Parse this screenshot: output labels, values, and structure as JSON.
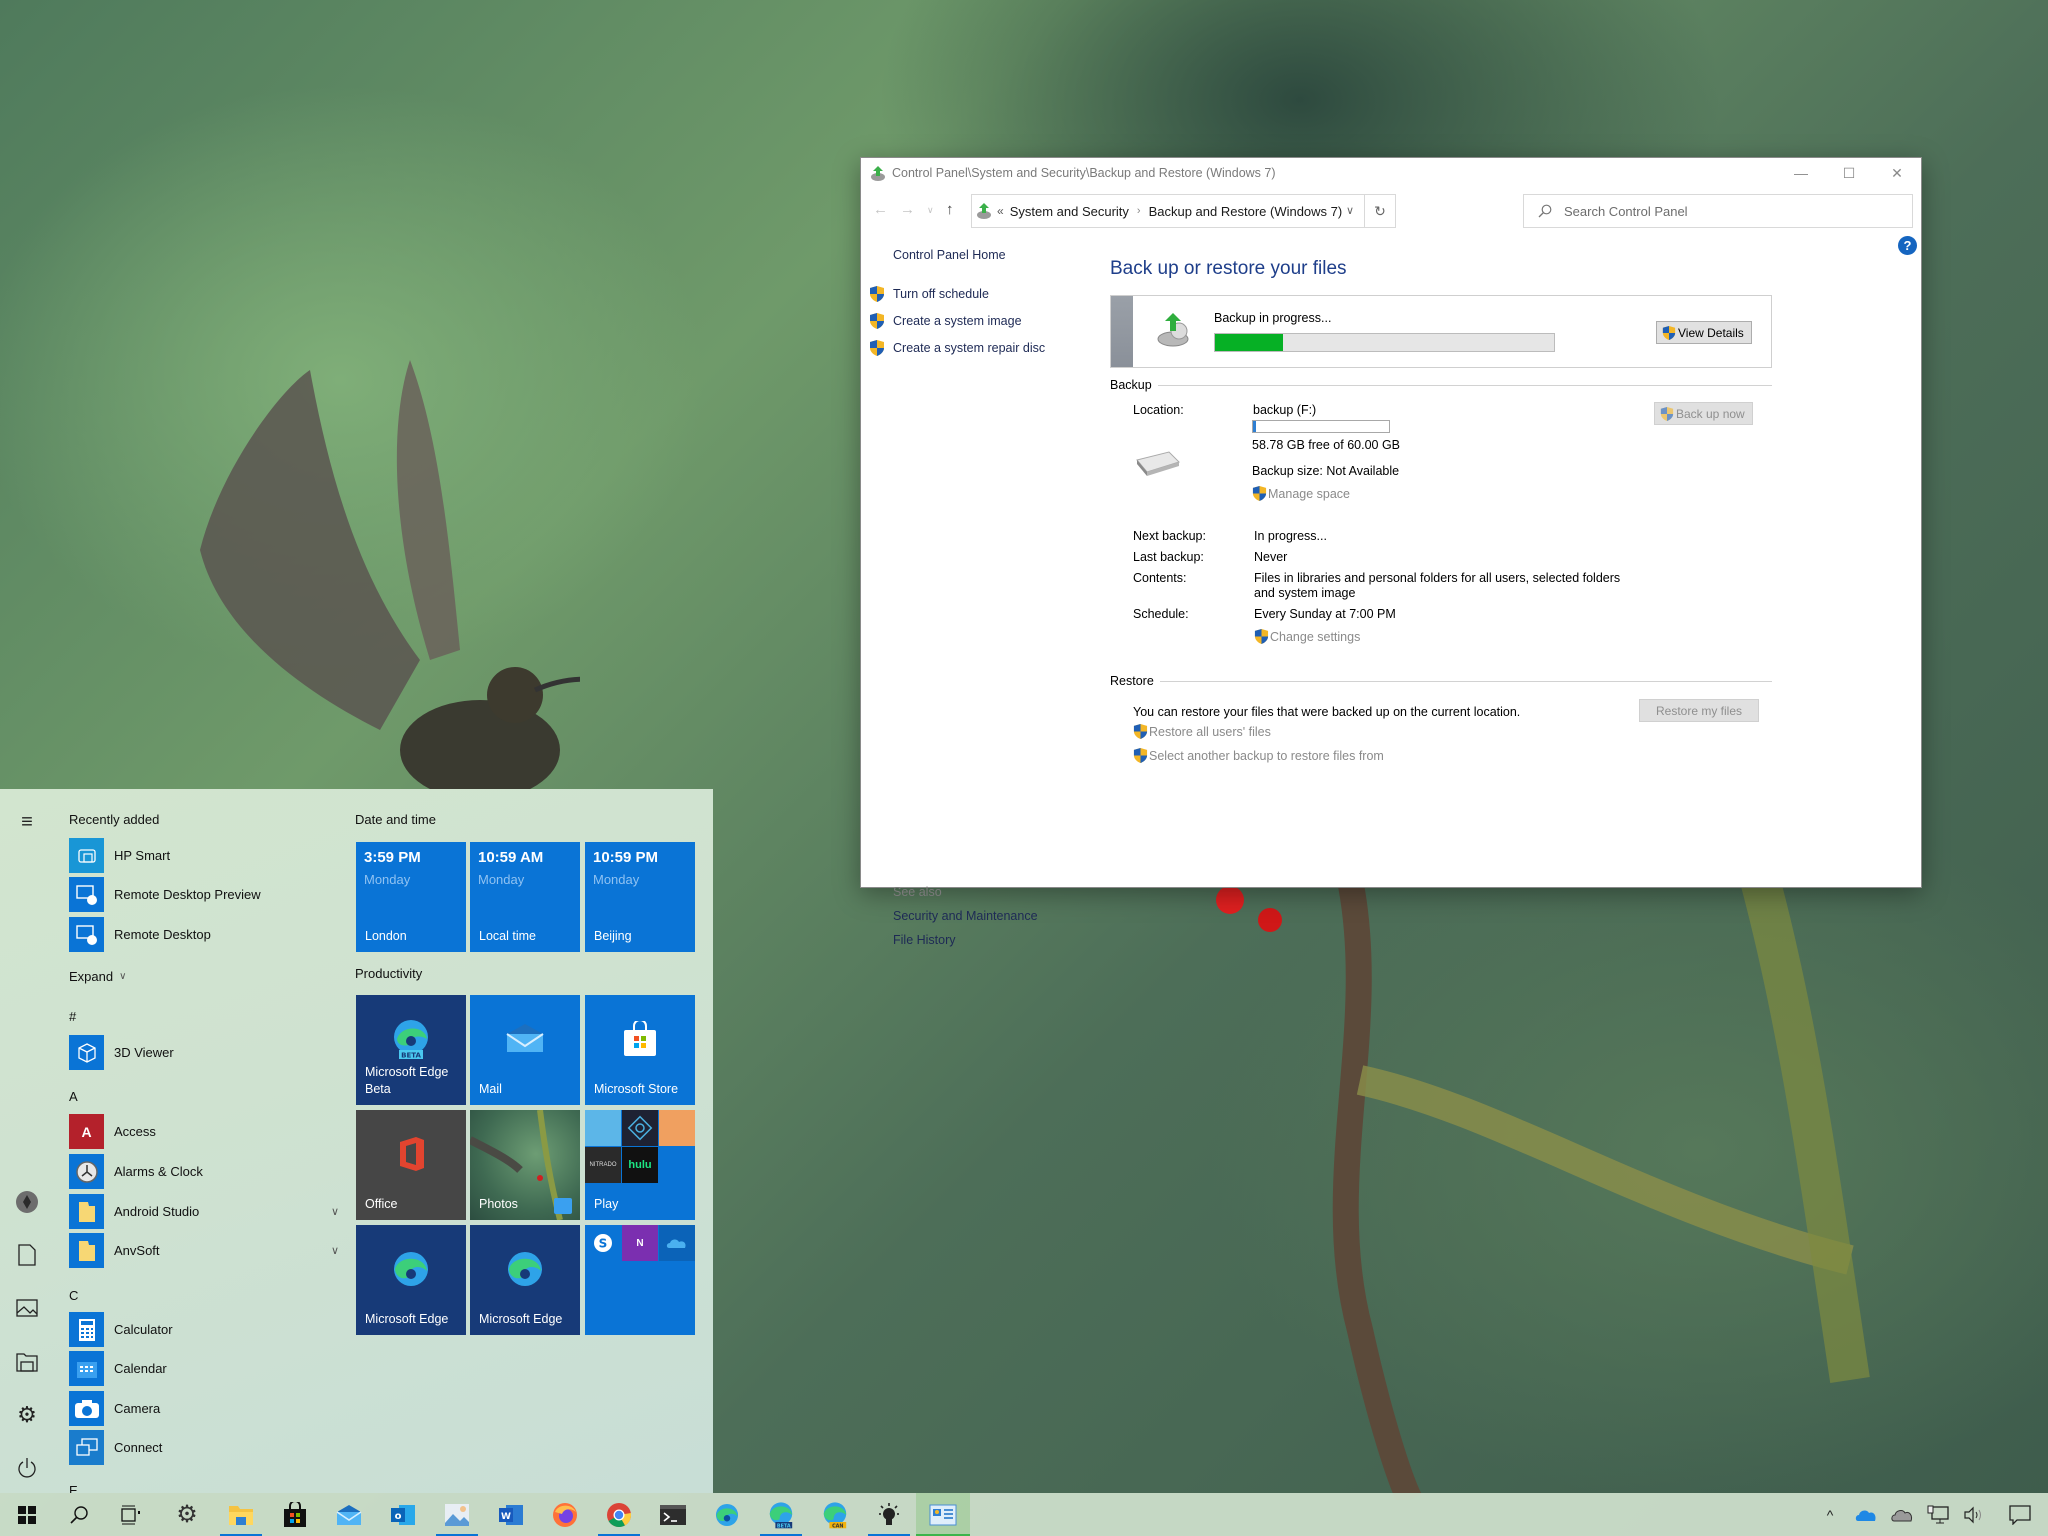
{
  "window": {
    "title": "Control Panel\\System and Security\\Backup and Restore (Windows 7)",
    "controls": {
      "minimize": "—",
      "maximize": "☐",
      "close": "✕"
    },
    "nav": {
      "back": "←",
      "forward": "→",
      "recent": "∨",
      "up": "↑",
      "breadcrumb_overflow": "«",
      "breadcrumb": [
        "System and Security",
        "Backup and Restore (Windows 7)"
      ],
      "breadcrumb_sep": "›",
      "dropdown": "∨",
      "refresh": "↻",
      "search_placeholder": "Search Control Panel"
    },
    "help": "?",
    "left_pane": {
      "home": "Control Panel Home",
      "tasks": [
        "Turn off schedule",
        "Create a system image",
        "Create a system repair disc"
      ],
      "see_also_header": "See also",
      "see_also": [
        "Security and Maintenance",
        "File History"
      ]
    },
    "main": {
      "title": "Back up or restore your files",
      "status": {
        "text": "Backup in progress...",
        "progress_fraction": 0.2,
        "view_details_label": "View Details"
      },
      "backup_section": {
        "header": "Backup",
        "location_label": "Location:",
        "location_value": "backup (F:)",
        "drive_used_fraction": 0.02,
        "free_space": "58.78 GB free of 60.00 GB",
        "backup_size": "Backup size: Not Available",
        "manage_space": "Manage space",
        "back_up_now": "Back up now",
        "next_backup_label": "Next backup:",
        "next_backup_value": "In progress...",
        "last_backup_label": "Last backup:",
        "last_backup_value": "Never",
        "contents_label": "Contents:",
        "contents_value": "Files in libraries and personal folders for all users, selected folders and system image",
        "schedule_label": "Schedule:",
        "schedule_value": "Every Sunday at 7:00 PM",
        "change_settings": "Change settings"
      },
      "restore_section": {
        "header": "Restore",
        "description": "You can restore your files that were backed up on the current location.",
        "restore_all_users": "Restore all users' files",
        "select_another": "Select another backup to restore files from",
        "restore_my_files": "Restore my files"
      }
    }
  },
  "start_menu": {
    "hamburger": "≡",
    "recently_added_header": "Recently added",
    "recently_added": [
      "HP Smart",
      "Remote Desktop Preview",
      "Remote Desktop"
    ],
    "expand_label": "Expand",
    "groups": [
      {
        "letter": "#",
        "apps": [
          {
            "name": "3D Viewer"
          }
        ]
      },
      {
        "letter": "A",
        "apps": [
          {
            "name": "Access"
          },
          {
            "name": "Alarms & Clock"
          },
          {
            "name": "Android Studio",
            "expandable": true
          },
          {
            "name": "AnvSoft",
            "expandable": true
          }
        ]
      },
      {
        "letter": "C",
        "apps": [
          {
            "name": "Calculator"
          },
          {
            "name": "Calendar"
          },
          {
            "name": "Camera"
          },
          {
            "name": "Connect"
          }
        ]
      },
      {
        "letter": "E",
        "apps": []
      }
    ],
    "rail": [
      "user-avatar",
      "documents",
      "pictures",
      "file-explorer",
      "settings",
      "power"
    ],
    "tiles": {
      "date_time_header": "Date and time",
      "clocks": [
        {
          "time": "3:59 PM",
          "day": "Monday",
          "city": "London"
        },
        {
          "time": "10:59 AM",
          "day": "Monday",
          "city": "Local time"
        },
        {
          "time": "10:59 PM",
          "day": "Monday",
          "city": "Beijing"
        }
      ],
      "productivity_header": "Productivity",
      "apps": [
        {
          "label": "Microsoft Edge Beta",
          "badge": "BETA"
        },
        {
          "label": "Mail"
        },
        {
          "label": "Microsoft Store"
        },
        {
          "label": "Office"
        },
        {
          "label": "Photos"
        },
        {
          "label": "Play",
          "mini": [
            "Candy",
            "Photoshop Express",
            "Candy Crush Friends",
            "Nitrado",
            "hulu"
          ]
        },
        {
          "label": "Microsoft Edge"
        },
        {
          "label": "Microsoft Edge"
        },
        {
          "label": "",
          "mini": [
            "Skype",
            "OneNote",
            "OneDrive"
          ]
        }
      ]
    }
  },
  "taskbar": {
    "items": [
      "Start",
      "Search",
      "Task View",
      "Settings",
      "File Explorer",
      "Microsoft Store",
      "Mail",
      "Outlook",
      "Photos",
      "Word",
      "Firefox",
      "Chrome",
      "Terminal",
      "Microsoft Edge",
      "Microsoft Edge Beta",
      "Microsoft Edge Canary",
      "Tips",
      "Control Panel"
    ],
    "running": [
      "File Explorer",
      "Photos",
      "Chrome",
      "Microsoft Edge Beta",
      "Control Panel"
    ],
    "active": "Control Panel",
    "badges": {
      "edge_beta": "BETA",
      "edge_canary": "CAN",
      "hulu": "hulu"
    },
    "tray": [
      "show-hidden-icons",
      "onedrive",
      "onedrive-personal",
      "network",
      "volume",
      "action-center"
    ],
    "tray_chevron": "^"
  },
  "colors": {
    "accent": "#0a74d6",
    "progress_green": "#06b025",
    "title_blue": "#1e3e8a",
    "link_navy": "#1e2a55",
    "disabled_gray": "#8a8a8a"
  }
}
